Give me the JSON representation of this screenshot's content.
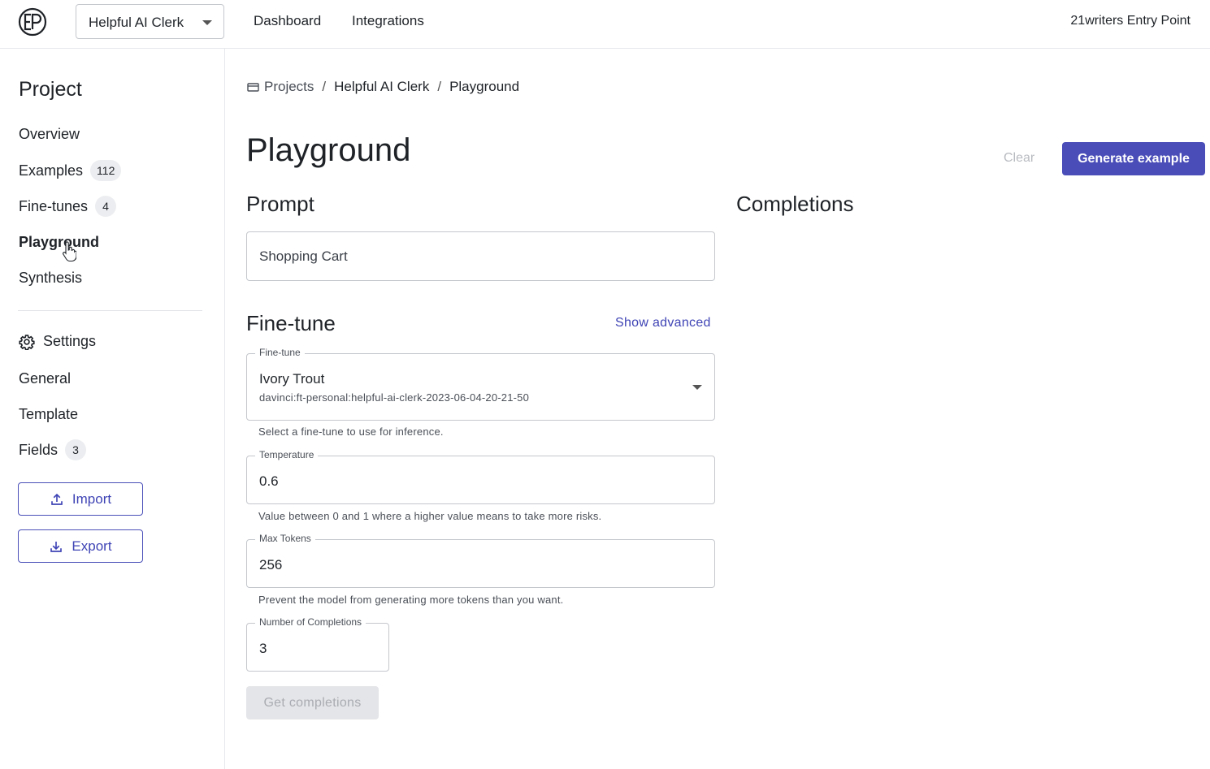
{
  "header": {
    "project_name": "Helpful AI Clerk",
    "nav": [
      "Dashboard",
      "Integrations"
    ],
    "user": "21writers Entry Point"
  },
  "sidebar": {
    "title": "Project",
    "items": [
      {
        "label": "Overview"
      },
      {
        "label": "Examples",
        "badge": "112"
      },
      {
        "label": "Fine-tunes",
        "badge": "4"
      },
      {
        "label": "Playground",
        "active": true
      },
      {
        "label": "Synthesis"
      }
    ],
    "settings_title": "Settings",
    "settings_items": [
      {
        "label": "General"
      },
      {
        "label": "Template"
      },
      {
        "label": "Fields",
        "badge": "3"
      }
    ],
    "import_label": "Import",
    "export_label": "Export"
  },
  "breadcrumb": [
    "Projects",
    "Helpful AI Clerk",
    "Playground"
  ],
  "page": {
    "title": "Playground",
    "clear_label": "Clear",
    "generate_label": "Generate example"
  },
  "prompt": {
    "title": "Prompt",
    "value": "Shopping Cart"
  },
  "completions": {
    "title": "Completions"
  },
  "finetune": {
    "title": "Fine-tune",
    "show_advanced": "Show advanced",
    "field_label": "Fine-tune",
    "selected_name": "Ivory Trout",
    "selected_id": "davinci:ft-personal:helpful-ai-clerk-2023-06-04-20-21-50",
    "helper": "Select a fine-tune to use for inference."
  },
  "temperature": {
    "label": "Temperature",
    "value": "0.6",
    "helper": "Value between 0 and 1 where a higher value means to take more risks."
  },
  "max_tokens": {
    "label": "Max Tokens",
    "value": "256",
    "helper": "Prevent the model from generating more tokens than you want."
  },
  "num_completions": {
    "label": "Number of Completions",
    "value": "3"
  },
  "get_completions_label": "Get completions",
  "colors": {
    "primary": "#4a4db8",
    "link": "#3f44b5",
    "disabled_bg": "#e4e5e8"
  }
}
